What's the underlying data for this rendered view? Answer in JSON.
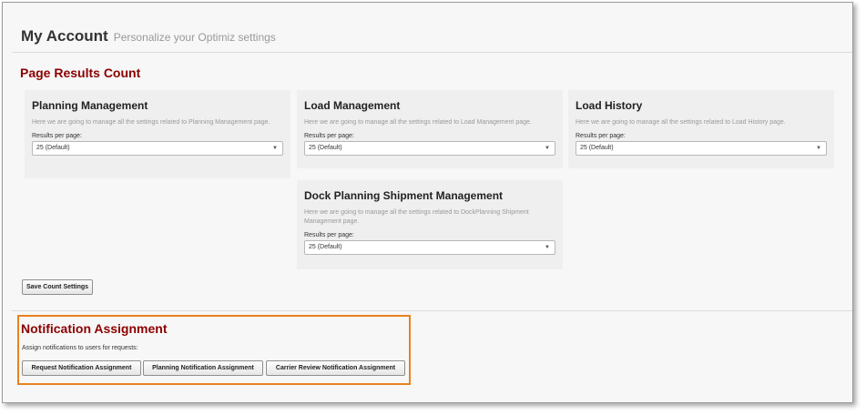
{
  "header": {
    "title": "My Account",
    "subtitle": "Personalize your Optimiz settings"
  },
  "page_results": {
    "section_title": "Page Results Count",
    "cards": [
      {
        "title": "Planning Management",
        "description": "Here we are going to manage all the settings related to Planning Management page.",
        "results_label": "Results per page:",
        "selected": "25 (Default)"
      },
      {
        "title": "Load Management",
        "description": "Here we are going to manage all the settings related to Load Management page.",
        "results_label": "Results per page:",
        "selected": "25 (Default)"
      },
      {
        "title": "Load History",
        "description": "Here we are going to manage all the settings related to Load History page.",
        "results_label": "Results per page:",
        "selected": "25 (Default)"
      },
      {
        "title": "Dock Planning Shipment Management",
        "description": "Here we are going to manage all the settings related to DockPlanning Shipment Management page.",
        "results_label": "Results per page:",
        "selected": "25 (Default)"
      }
    ],
    "save_button": "Save Count Settings"
  },
  "notification": {
    "section_title": "Notification Assignment",
    "description": "Assign notifications to users for requests:",
    "buttons": [
      "Request Notification Assignment",
      "Planning Notification Assignment",
      "Carrier Review Notification Assignment"
    ]
  },
  "icons": {
    "select_arrow": "chevron-down-icon"
  },
  "colors": {
    "section_title": "#8b0000",
    "highlight_border": "#e8821e"
  }
}
